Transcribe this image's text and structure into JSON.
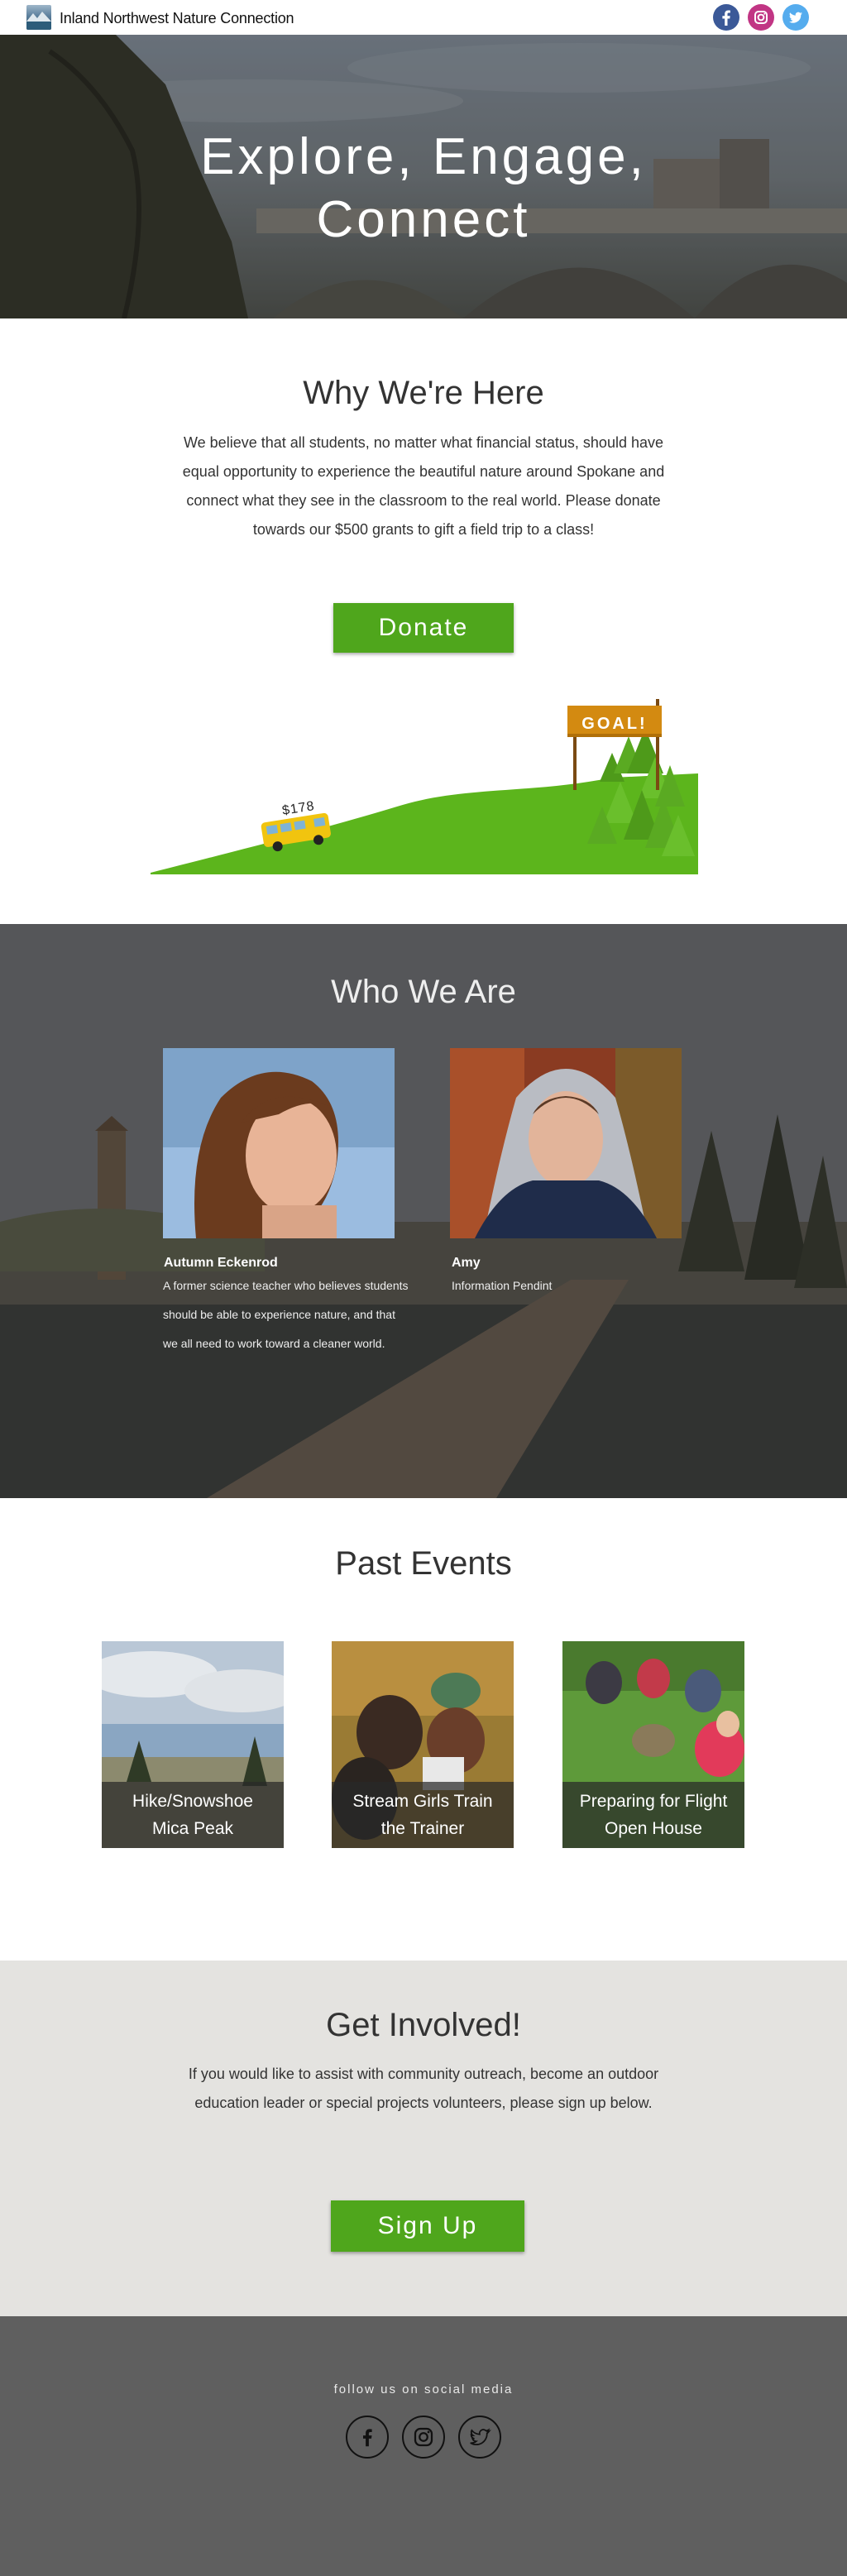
{
  "header": {
    "brand": "Inland Northwest Nature Connection",
    "logo_icon": "mountain-lake-logo",
    "social": [
      {
        "name": "facebook-icon",
        "color": "#3b5998"
      },
      {
        "name": "instagram-icon",
        "color": "#c13584"
      },
      {
        "name": "twitter-icon",
        "color": "#55acee"
      }
    ]
  },
  "hero": {
    "title_line1": "Explore, Engage,",
    "title_line2": "Connect"
  },
  "why": {
    "title": "Why We're Here",
    "text": "We believe that all students, no matter what financial status, should have equal opportunity to experience the beautiful nature around Spokane and connect what they see in the classroom to the real world. Please donate towards our $500 grants to gift a field trip to a class!",
    "donate_label": "Donate",
    "progress_amount": "$178",
    "goal_label": "GOAL!",
    "progress_fraction": 0.356
  },
  "who": {
    "title": "Who We Are",
    "members": [
      {
        "name": "Autumn Eckenrod",
        "bio": "A former science teacher who believes students should be able to experience nature, and that we all need to work toward a cleaner world."
      },
      {
        "name": "Amy",
        "bio": "Information Pendint"
      }
    ]
  },
  "events": {
    "title": "Past Events",
    "items": [
      {
        "label": "Hike/Snowshoe Mica Peak"
      },
      {
        "label": "Stream Girls Train the Trainer"
      },
      {
        "label": "Preparing for Flight Open House"
      }
    ]
  },
  "involved": {
    "title": "Get Involved!",
    "text": "If you would like to assist with community outreach, become an outdoor education leader or special projects volunteers, please sign up below.",
    "signup_label": "Sign Up"
  },
  "footer": {
    "follow_text": "follow us on social media",
    "icons": [
      "facebook-icon",
      "instagram-icon",
      "twitter-icon"
    ]
  },
  "colors": {
    "accent_green": "#4fa61c",
    "goal_sign": "#d38a11",
    "footer_bg": "#5f5f5f",
    "involved_bg": "#e4e3e0"
  }
}
